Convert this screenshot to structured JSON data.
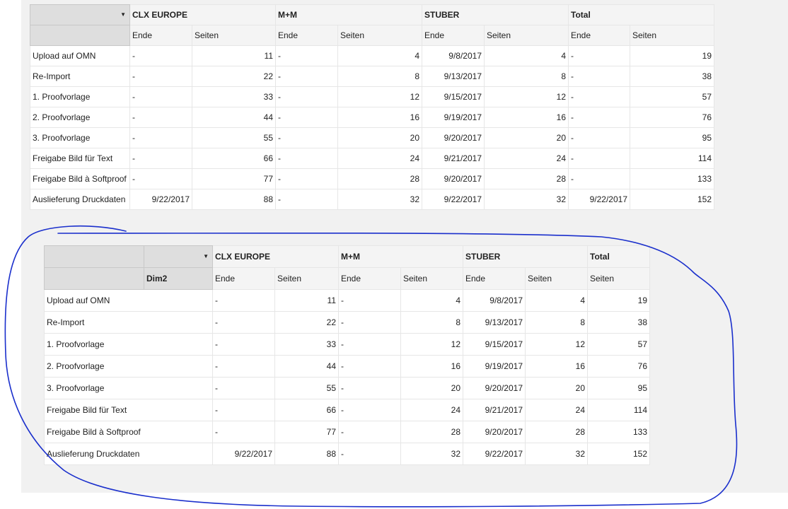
{
  "table1": {
    "groups": [
      "CLX EUROPE",
      "M+M",
      "STUBER",
      "Total"
    ],
    "subheaders": [
      "Ende",
      "Seiten",
      "Ende",
      "Seiten",
      "Ende",
      "Seiten",
      "Ende",
      "Seiten"
    ],
    "rows": [
      {
        "label": "Upload auf OMN",
        "cells": [
          "-",
          "11",
          "-",
          "4",
          "9/8/2017",
          "4",
          "-",
          "19"
        ]
      },
      {
        "label": "Re-Import",
        "cells": [
          "-",
          "22",
          "-",
          "8",
          "9/13/2017",
          "8",
          "-",
          "38"
        ]
      },
      {
        "label": "1. Proofvorlage",
        "cells": [
          "-",
          "33",
          "-",
          "12",
          "9/15/2017",
          "12",
          "-",
          "57"
        ]
      },
      {
        "label": "2. Proofvorlage",
        "cells": [
          "-",
          "44",
          "-",
          "16",
          "9/19/2017",
          "16",
          "-",
          "76"
        ]
      },
      {
        "label": "3. Proofvorlage",
        "cells": [
          "-",
          "55",
          "-",
          "20",
          "9/20/2017",
          "20",
          "-",
          "95"
        ]
      },
      {
        "label": "Freigabe Bild für Text",
        "cells": [
          "-",
          "66",
          "-",
          "24",
          "9/21/2017",
          "24",
          "-",
          "114"
        ]
      },
      {
        "label": "Freigabe Bild à Softproof",
        "cells": [
          "-",
          "77",
          "-",
          "28",
          "9/20/2017",
          "28",
          "-",
          "133"
        ]
      },
      {
        "label": "Auslieferung Druckdaten",
        "cells": [
          "9/22/2017",
          "88",
          "-",
          "32",
          "9/22/2017",
          "32",
          "9/22/2017",
          "152"
        ]
      }
    ]
  },
  "table2": {
    "dim_label": "Dim2",
    "groups": [
      "CLX EUROPE",
      "M+M",
      "STUBER",
      "Total"
    ],
    "subheaders": [
      "Ende",
      "Seiten",
      "Ende",
      "Seiten",
      "Ende",
      "Seiten",
      "Seiten"
    ],
    "rows": [
      {
        "label": "Upload auf OMN",
        "cells": [
          "-",
          "11",
          "-",
          "4",
          "9/8/2017",
          "4",
          "19"
        ]
      },
      {
        "label": "Re-Import",
        "cells": [
          "-",
          "22",
          "-",
          "8",
          "9/13/2017",
          "8",
          "38"
        ]
      },
      {
        "label": "1. Proofvorlage",
        "cells": [
          "-",
          "33",
          "-",
          "12",
          "9/15/2017",
          "12",
          "57"
        ]
      },
      {
        "label": "2. Proofvorlage",
        "cells": [
          "-",
          "44",
          "-",
          "16",
          "9/19/2017",
          "16",
          "76"
        ]
      },
      {
        "label": "3. Proofvorlage",
        "cells": [
          "-",
          "55",
          "-",
          "20",
          "9/20/2017",
          "20",
          "95"
        ]
      },
      {
        "label": "Freigabe Bild für Text",
        "cells": [
          "-",
          "66",
          "-",
          "24",
          "9/21/2017",
          "24",
          "114"
        ]
      },
      {
        "label": "Freigabe Bild à Softproof",
        "cells": [
          "-",
          "77",
          "-",
          "28",
          "9/20/2017",
          "28",
          "133"
        ]
      },
      {
        "label": "Auslieferung Druckdaten",
        "cells": [
          "9/22/2017",
          "88",
          "-",
          "32",
          "9/22/2017",
          "32",
          "152"
        ]
      }
    ]
  },
  "annotation": {
    "color": "#1a2fcc"
  },
  "icons": {
    "dropdown": "dropdown-arrow-icon"
  }
}
